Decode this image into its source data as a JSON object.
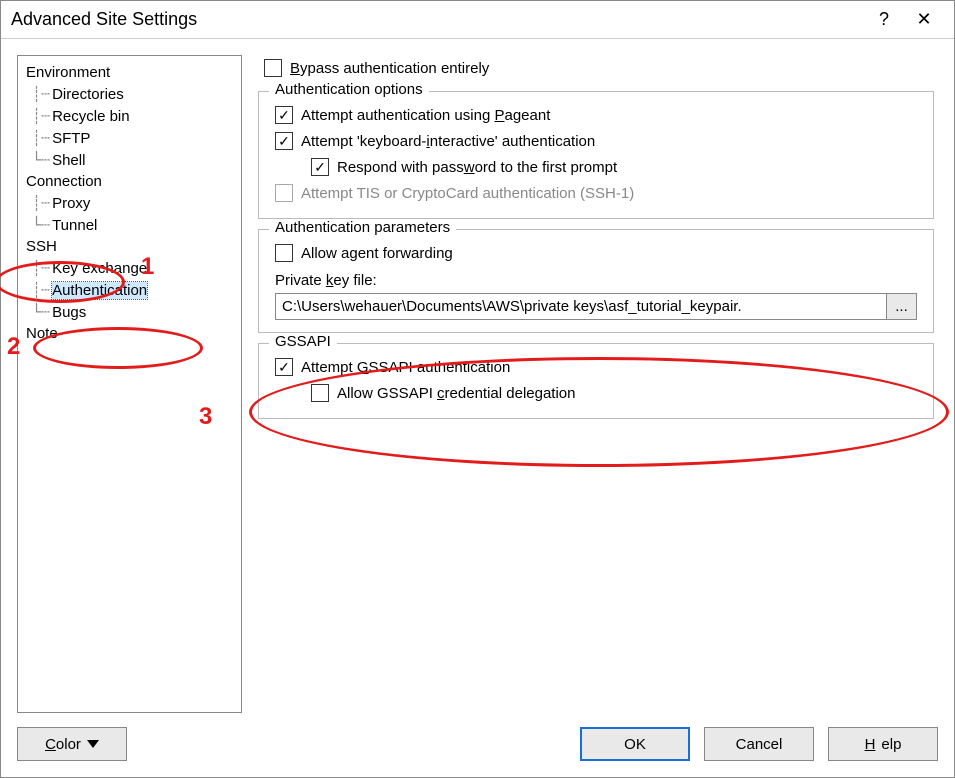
{
  "window": {
    "title": "Advanced Site Settings"
  },
  "sidebar": {
    "groups": [
      {
        "label": "Environment",
        "items": [
          {
            "label": "Directories"
          },
          {
            "label": "Recycle bin"
          },
          {
            "label": "SFTP"
          },
          {
            "label": "Shell"
          }
        ]
      },
      {
        "label": "Connection",
        "items": [
          {
            "label": "Proxy"
          },
          {
            "label": "Tunnel"
          }
        ]
      },
      {
        "label": "SSH",
        "items": [
          {
            "label": "Key exchange"
          },
          {
            "label": "Authentication",
            "selected": true
          },
          {
            "label": "Bugs"
          }
        ]
      },
      {
        "label": "Note",
        "items": []
      }
    ]
  },
  "main": {
    "bypass": {
      "label_pre": "",
      "label": "Bypass authentication entirely",
      "ul": "B",
      "checked": false
    },
    "auth_options": {
      "legend": "Authentication options",
      "pageant": {
        "label": "Attempt authentication using Pageant",
        "ul": "P",
        "checked": true
      },
      "ki": {
        "label": "Attempt 'keyboard-interactive' authentication",
        "ul": "i",
        "checked": true
      },
      "respond": {
        "label": "Respond with password to the first prompt",
        "ul": "w",
        "checked": true
      },
      "tis": {
        "label": "Attempt TIS or CryptoCard authentication (SSH-1)",
        "checked": false,
        "disabled": true
      }
    },
    "auth_params": {
      "legend": "Authentication parameters",
      "agent_fwd": {
        "label": "Allow agent forwarding",
        "ul": "g",
        "checked": false
      },
      "pk_label": "Private key file:",
      "pk_ul": "k",
      "pk_value": "C:\\Users\\wehauer\\Documents\\AWS\\private keys\\asf_tutorial_keypair.",
      "browse": "..."
    },
    "gssapi": {
      "legend": "GSSAPI",
      "attempt": {
        "label": "Attempt GSSAPI authentication",
        "ul": "G",
        "checked": true
      },
      "delegate": {
        "label": "Allow GSSAPI credential delegation",
        "ul": "c",
        "checked": false
      }
    }
  },
  "footer": {
    "color": "Color",
    "color_ul": "C",
    "ok": "OK",
    "cancel": "Cancel",
    "help": "Help",
    "help_ul": "H"
  },
  "annotations": {
    "n1": "1",
    "n2": "2",
    "n3": "3"
  }
}
